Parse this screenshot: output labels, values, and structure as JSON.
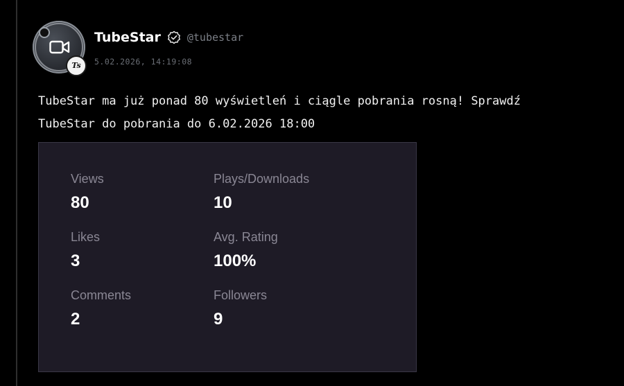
{
  "post": {
    "display_name": "TubeStar",
    "handle": "@tubestar",
    "timestamp": "5.02.2026, 14:19:08",
    "avatar_badge": "Ts",
    "text_line1": "TubeStar ma już ponad 80 wyświetleń i ciągle pobrania rosną! Sprawdź",
    "text_line2": "TubeStar do pobrania do 6.02.2026 18:00"
  },
  "stats": {
    "views": {
      "label": "Views",
      "value": "80"
    },
    "plays_downloads": {
      "label": "Plays/Downloads",
      "value": "10"
    },
    "likes": {
      "label": "Likes",
      "value": "3"
    },
    "avg_rating": {
      "label": "Avg. Rating",
      "value": "100%"
    },
    "comments": {
      "label": "Comments",
      "value": "2"
    },
    "followers": {
      "label": "Followers",
      "value": "9"
    }
  },
  "icons": {
    "avatar": "video-camera-icon",
    "verified": "verified-check-icon"
  },
  "colors": {
    "background": "#000000",
    "card_background": "#1e1b26",
    "card_border": "#3a3746",
    "label_muted": "#8a8794",
    "handle_muted": "#7b7f86"
  }
}
